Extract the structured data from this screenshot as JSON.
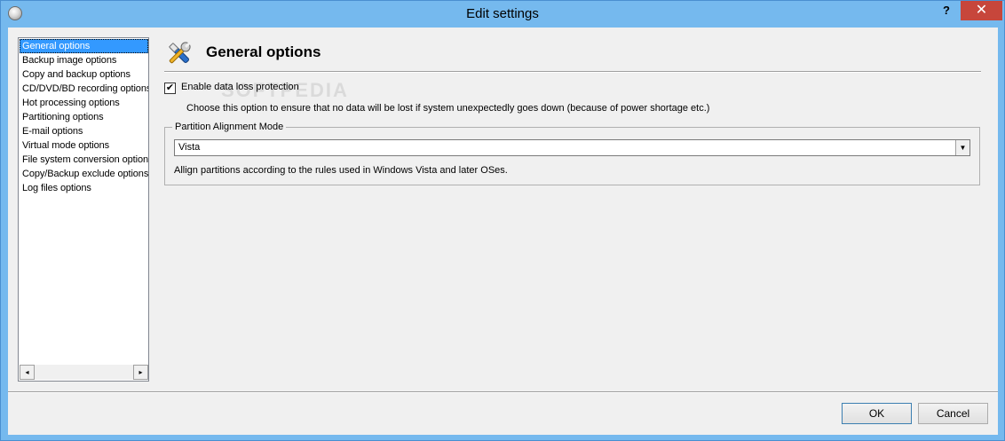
{
  "window": {
    "title": "Edit settings",
    "help_label": "?",
    "close_label": "✕"
  },
  "nav": {
    "items": [
      "General options",
      "Backup image options",
      "Copy and backup options",
      "CD/DVD/BD recording options",
      "Hot processing options",
      "Partitioning options",
      "E-mail options",
      "Virtual mode options",
      "File system conversion options",
      "Copy/Backup exclude options",
      "Log files options"
    ],
    "selected_index": 0,
    "scroll_left": "◂",
    "scroll_right": "▸"
  },
  "panel": {
    "title": "General options",
    "icon": "tools-icon",
    "data_loss": {
      "checked": true,
      "check_mark": "✔",
      "label": "Enable data loss protection",
      "description": "Choose this option to ensure that no data will be lost if system unexpectedly goes down (because of power shortage etc.)"
    },
    "partition_alignment": {
      "legend": "Partition Alignment Mode",
      "selected": "Vista",
      "arrow": "▼",
      "description": "Allign partitions according to the rules used in Windows Vista and later OSes."
    }
  },
  "footer": {
    "ok_label": "OK",
    "cancel_label": "Cancel"
  },
  "colors": {
    "titlebar": "#75b9ee",
    "close": "#c7463b",
    "selection": "#3399ff"
  }
}
